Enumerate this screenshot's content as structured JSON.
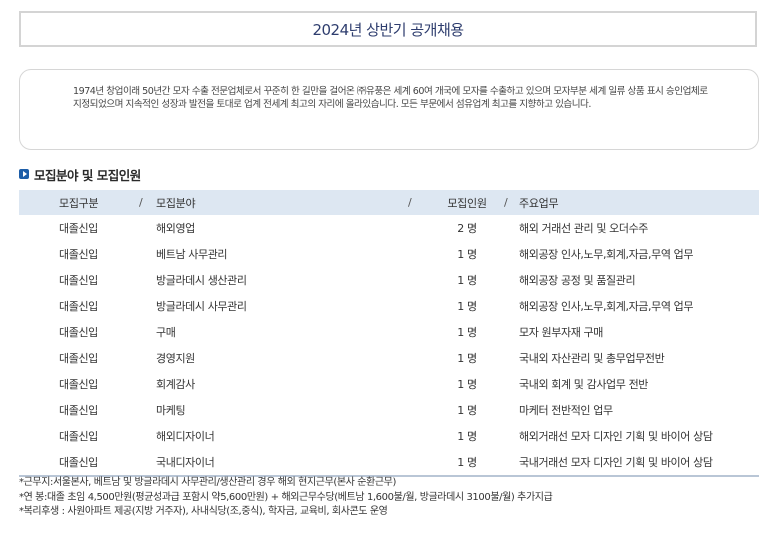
{
  "title": "2024년 상반기 공개채용",
  "intro": "1974년 창업이래 50년간 모자 수출 전문업체로서 꾸준히 한 길만을 걸어온 ㈜유풍은 세계 60여 개국에 모자를 수출하고 있으며 모자부분 세계 일류 상품 표시 승인업체로 지정되었으며 지속적인 성장과 발전을 토대로 업계 전세계 최고의 자리에 올라있습니다. 모든 부문에서 섬유업계 최고를 지향하고 있습니다.",
  "section_title": "모집분야 및 모집인원",
  "table": {
    "headers": [
      "모집구분",
      "모집분야",
      "모집인원",
      "주요업무"
    ],
    "separator": "/",
    "rows": [
      {
        "type": "대졸신입",
        "field": "해외영업",
        "count": "2 명",
        "duty": "해외 거래선 관리 및 오더수주"
      },
      {
        "type": "대졸신입",
        "field": "베트남 사무관리",
        "count": "1 명",
        "duty": "해외공장 인사,노무,회계,자금,무역 업무"
      },
      {
        "type": "대졸신입",
        "field": "방글라데시 생산관리",
        "count": "1 명",
        "duty": "해외공장 공정 및 품질관리"
      },
      {
        "type": "대졸신입",
        "field": "방글라데시 사무관리",
        "count": "1 명",
        "duty": "해외공장 인사,노무,회계,자금,무역 업무"
      },
      {
        "type": "대졸신입",
        "field": "구매",
        "count": "1 명",
        "duty": "모자 원부자재 구매"
      },
      {
        "type": "대졸신입",
        "field": "경영지원",
        "count": "1 명",
        "duty": "국내외 자산관리 및 총무업무전반"
      },
      {
        "type": "대졸신입",
        "field": "회계감사",
        "count": "1 명",
        "duty": "국내외 회계 및 감사업무 전반"
      },
      {
        "type": "대졸신입",
        "field": "마케팅",
        "count": "1 명",
        "duty": "마케터 전반적인 업무"
      },
      {
        "type": "대졸신입",
        "field": "해외디자이너",
        "count": "1 명",
        "duty": "해외거래선 모자 디자인 기획 및 바이어 상담"
      },
      {
        "type": "대졸신입",
        "field": "국내디자이너",
        "count": "1 명",
        "duty": "국내거래선 모자 디자인 기획 및 바이어 상담"
      }
    ]
  },
  "notes": [
    "*근무지:서울본사, 베트남 및 방글라데시 사무관리/생산관리 경우 해외 현지근무(본사 순환근무)",
    "*연 봉:대졸 초임 4,500만원(평균성과급 포함시 약5,600만원) + 해외근무수당(베트남 1,600불/월, 방글라데시 3100불/월) 추가지급",
    "*복리후생 : 사원아파트 제공(지방 거주자), 사내식당(조,중식), 학자금, 교육비, 회사콘도 운영"
  ],
  "colors": {
    "title_text": "#2e3d6e",
    "header_bg": "#dde7f2",
    "accent": "#1c5da8"
  }
}
